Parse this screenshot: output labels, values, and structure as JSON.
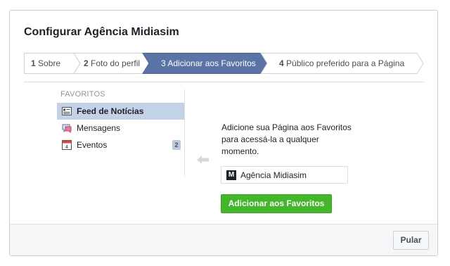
{
  "dialog": {
    "title": "Configurar Agência Midiasim"
  },
  "steps": [
    {
      "number": "1",
      "label": "Sobre",
      "active": false
    },
    {
      "number": "2",
      "label": "Foto do perfil",
      "active": false
    },
    {
      "number": "3",
      "label": "Adicionar aos Favoritos",
      "active": true
    },
    {
      "number": "4",
      "label": "Público preferido para a Página",
      "active": false
    }
  ],
  "favorites": {
    "heading": "FAVORITOS",
    "items": [
      {
        "label": "Feed de Notícias",
        "icon": "news-feed-icon",
        "selected": true
      },
      {
        "label": "Mensagens",
        "icon": "messages-icon",
        "selected": false
      },
      {
        "label": "Eventos",
        "icon": "calendar-icon",
        "selected": false,
        "badge": "2",
        "icon_text": "4"
      }
    ]
  },
  "main": {
    "description": "Adicione sua Página aos Favoritos para acessá-la a qualquer momento.",
    "page_name": "Agência Midiasim",
    "page_logo": "M",
    "add_button": "Adicionar aos Favoritos"
  },
  "footer": {
    "skip_button": "Pular"
  },
  "colors": {
    "active_step": "#5b74a8",
    "add_button": "#42b72a",
    "selected_item": "#c4d2e7"
  }
}
